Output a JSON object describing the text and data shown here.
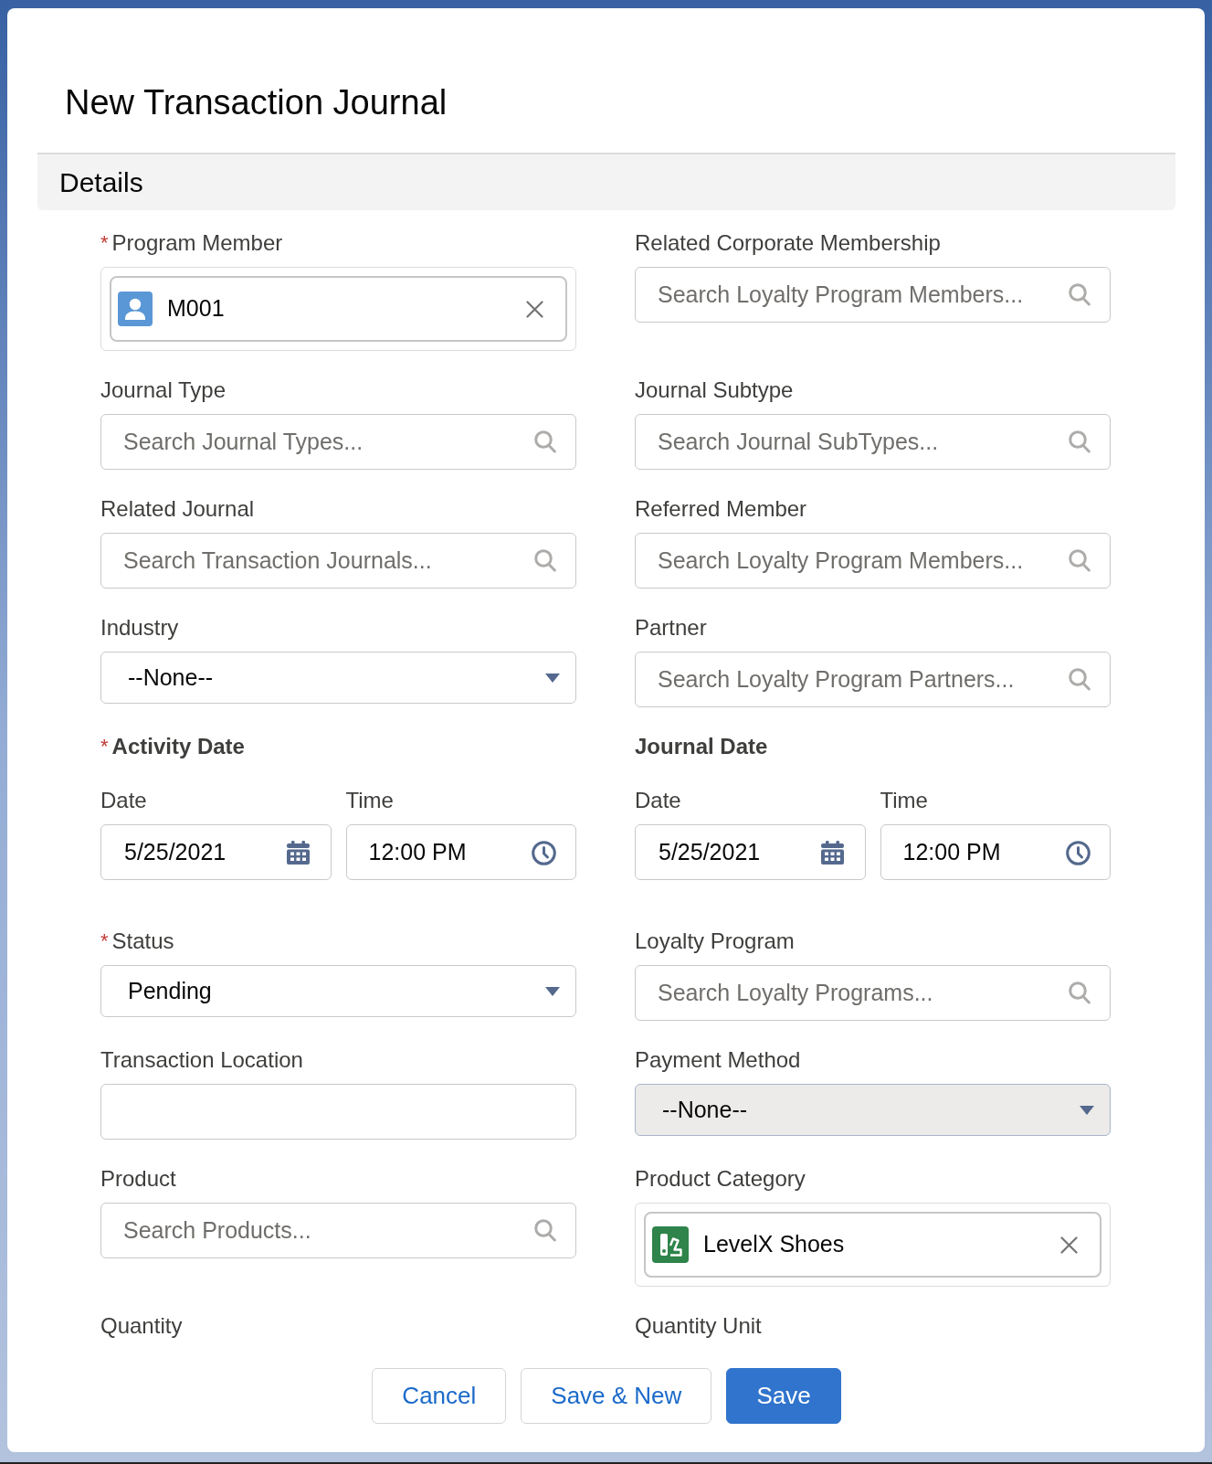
{
  "modal": {
    "title": "New Transaction Journal"
  },
  "section": {
    "title": "Details",
    "fields": [
      {
        "label": "Program Member",
        "required_mark": "*",
        "kind": "lookup_selected",
        "selection": {
          "kind": "member",
          "text": "M001"
        }
      },
      {
        "label": "Related Corporate Membership",
        "kind": "lookup",
        "placeholder": "Search Loyalty Program Members..."
      },
      {
        "label": "Journal Type",
        "kind": "lookup",
        "placeholder": "Search Journal Types..."
      },
      {
        "label": "Journal Subtype",
        "kind": "lookup",
        "placeholder": "Search Journal SubTypes..."
      },
      {
        "label": "Related Journal",
        "kind": "lookup",
        "placeholder": "Search Transaction Journals..."
      },
      {
        "label": "Referred Member",
        "kind": "lookup",
        "placeholder": "Search Loyalty Program Members..."
      },
      {
        "label": "Industry",
        "kind": "picklist",
        "value": "--None--",
        "disabled": false
      },
      {
        "label": "Partner",
        "kind": "lookup",
        "placeholder": "Search Loyalty Program Partners..."
      },
      {
        "label": "Activity Date",
        "required_mark": "*",
        "kind": "datetime",
        "date_label": "Date",
        "date": "5/25/2021",
        "time_label": "Time",
        "time": "12:00 PM"
      },
      {
        "label": "Journal Date",
        "kind": "datetime",
        "date_label": "Date",
        "date": "5/25/2021",
        "time_label": "Time",
        "time": "12:00 PM"
      },
      {
        "label": "Status",
        "required_mark": "*",
        "kind": "picklist",
        "value": "Pending",
        "disabled": false
      },
      {
        "label": "Loyalty Program",
        "kind": "lookup",
        "placeholder": "Search Loyalty Programs..."
      },
      {
        "label": "Transaction Location",
        "kind": "text"
      },
      {
        "label": "Payment Method",
        "kind": "picklist",
        "value": "--None--",
        "disabled": true
      },
      {
        "label": "Product",
        "kind": "lookup",
        "placeholder": "Search Products..."
      },
      {
        "label": "Product Category",
        "kind": "lookup_selected",
        "selection": {
          "kind": "category",
          "text": "LevelX Shoes"
        }
      },
      {
        "label": "Quantity",
        "kind": "label"
      },
      {
        "label": "Quantity Unit",
        "kind": "label"
      }
    ]
  },
  "footer": {
    "buttons": [
      {
        "label": "Cancel",
        "kind": "neutral"
      },
      {
        "label": "Save & New",
        "kind": "neutral"
      },
      {
        "label": "Save",
        "kind": "brand"
      }
    ]
  }
}
